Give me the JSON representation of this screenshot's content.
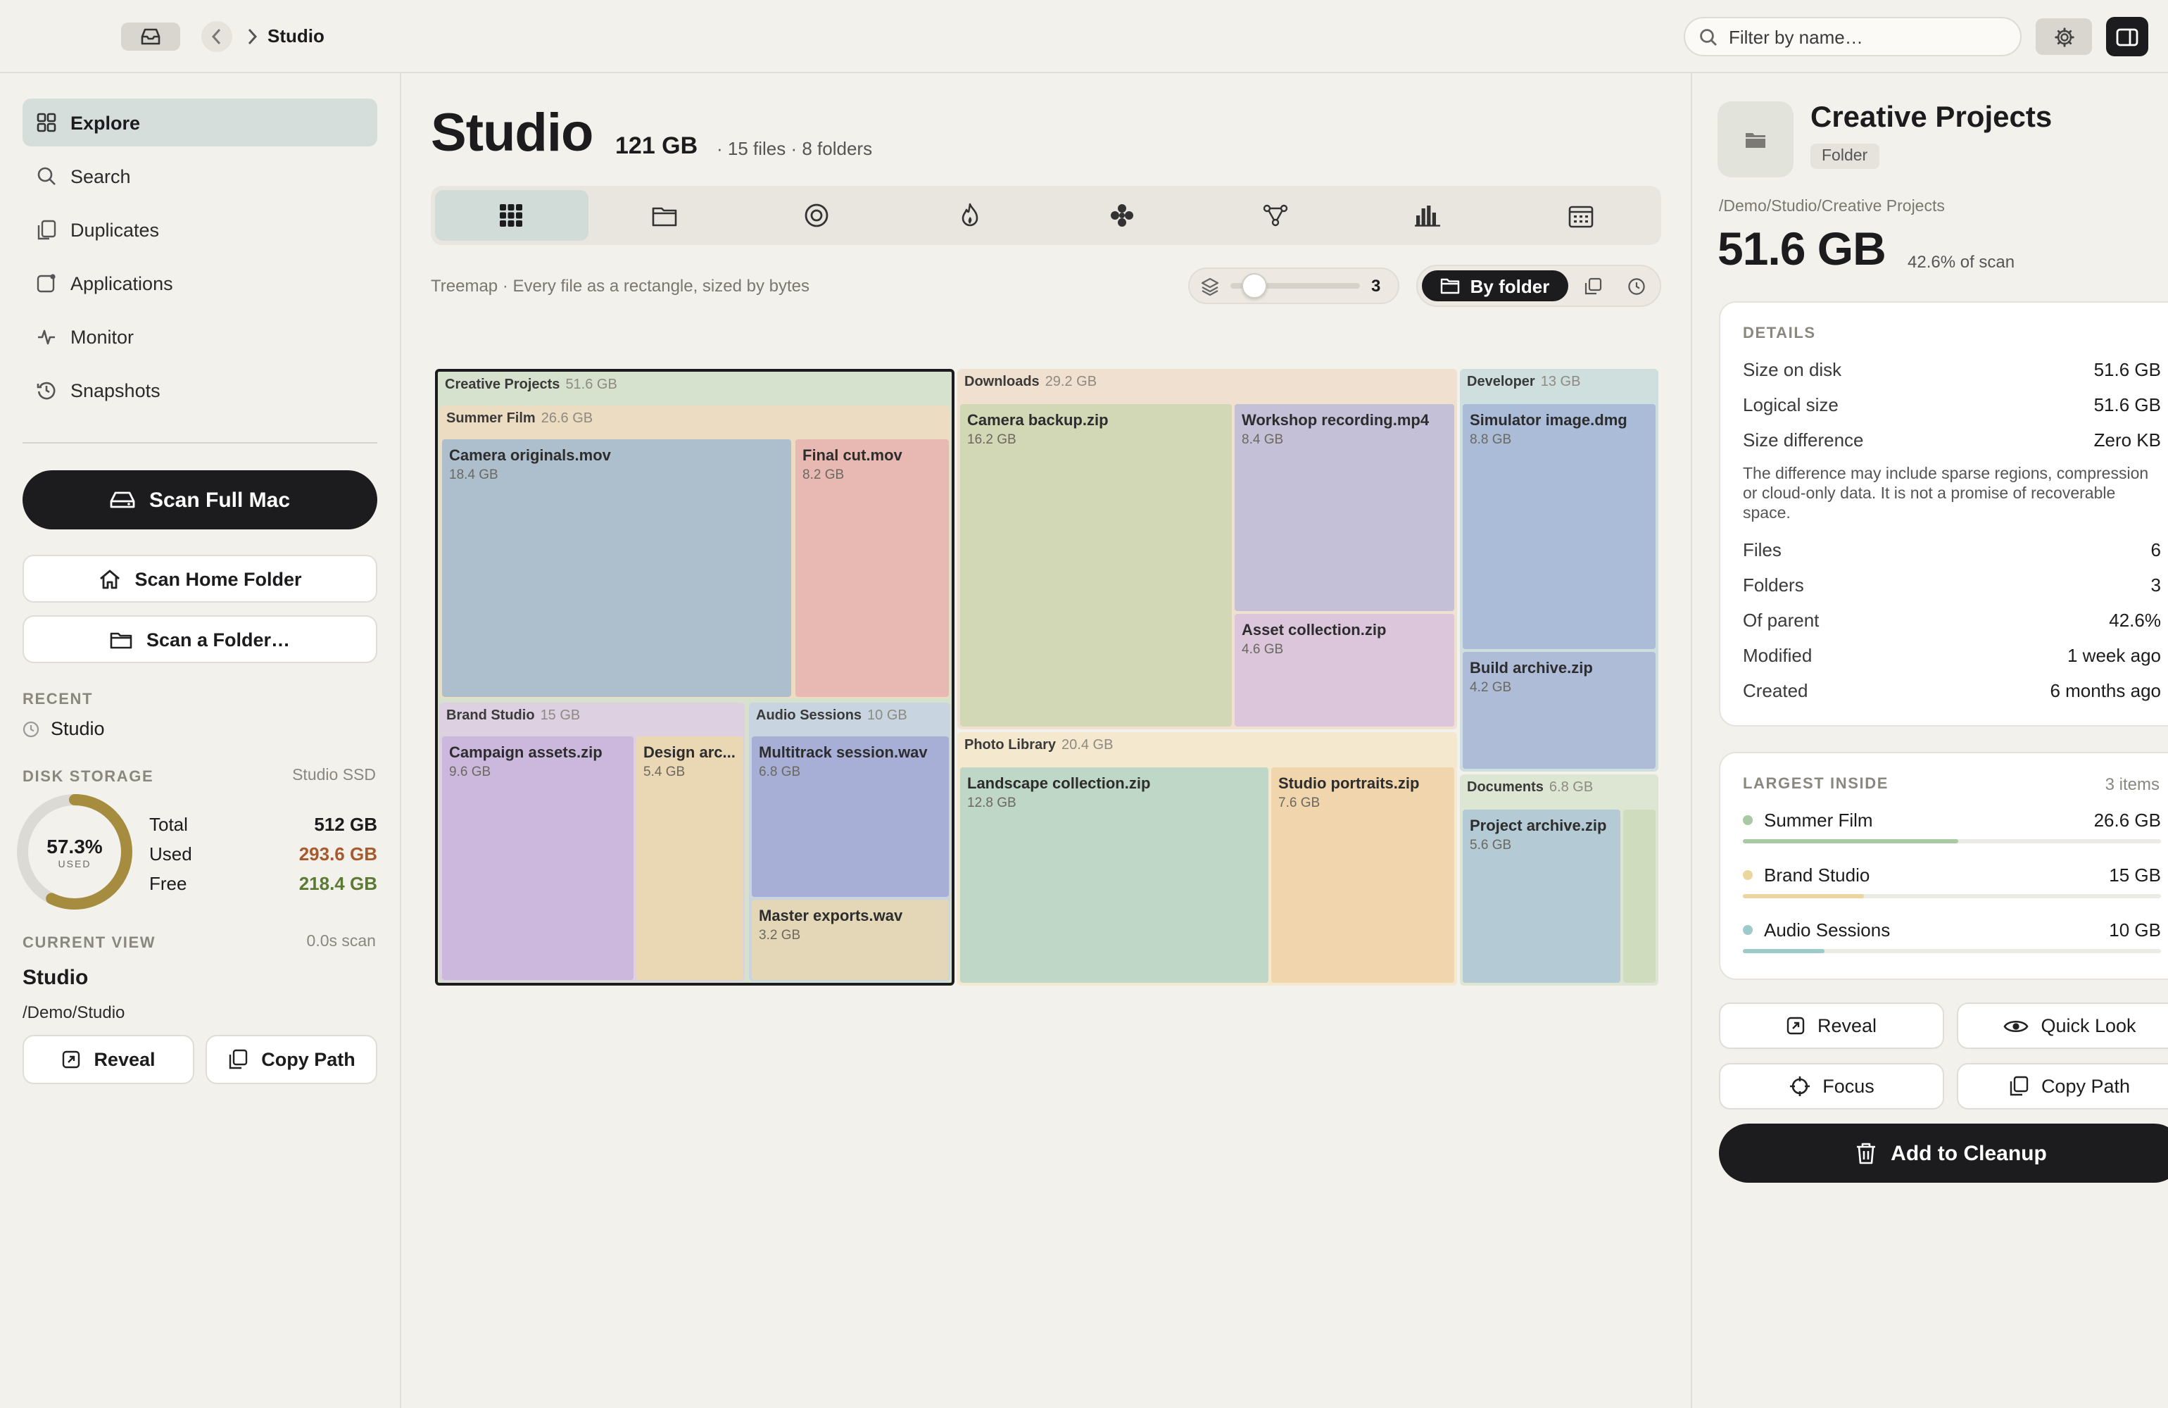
{
  "topbar": {
    "title": "Studio",
    "search_placeholder": "Filter by name…"
  },
  "sidebar": {
    "nav": [
      {
        "label": "Explore",
        "icon": "grid-icon",
        "active": true
      },
      {
        "label": "Search",
        "icon": "search-icon"
      },
      {
        "label": "Duplicates",
        "icon": "duplicates-icon"
      },
      {
        "label": "Applications",
        "icon": "applications-icon"
      },
      {
        "label": "Monitor",
        "icon": "pulse-icon"
      },
      {
        "label": "Snapshots",
        "icon": "history-icon"
      }
    ],
    "scan_full": "Scan Full Mac",
    "scan_home": "Scan Home Folder",
    "scan_folder": "Scan a Folder…",
    "recent_label": "RECENT",
    "recent_item": "Studio",
    "disk_label": "DISK STORAGE",
    "disk_name": "Studio SSD",
    "disk_pct": "57.3%",
    "disk_pct_value": 57.3,
    "disk_used_caption": "USED",
    "total_label": "Total",
    "total_value": "512 GB",
    "used_label": "Used",
    "used_value": "293.6 GB",
    "free_label": "Free",
    "free_value": "218.4 GB",
    "current_label": "CURRENT VIEW",
    "scan_time": "0.0s scan",
    "current_name": "Studio",
    "current_path": "/Demo/Studio",
    "reveal": "Reveal",
    "copy_path": "Copy Path"
  },
  "main": {
    "title": "Studio",
    "size": "121 GB",
    "meta": "· 15 files · 8 folders",
    "view_tabs": [
      "treemap-icon",
      "folder-icon",
      "sunburst-icon",
      "flame-icon",
      "cluster-icon",
      "network-icon",
      "bar-chart-icon",
      "calendar-icon"
    ],
    "desc": "Treemap · Every file as a rectangle, sized by bytes",
    "depth_value": "3",
    "group_by": "By folder"
  },
  "treemap": {
    "creative": {
      "name": "Creative Projects",
      "size": "51.6 GB"
    },
    "summer": {
      "name": "Summer Film",
      "size": "26.6 GB"
    },
    "camera_originals": {
      "name": "Camera originals.mov",
      "size": "18.4 GB"
    },
    "final_cut": {
      "name": "Final cut.mov",
      "size": "8.2 GB"
    },
    "brand": {
      "name": "Brand Studio",
      "size": "15 GB"
    },
    "campaign": {
      "name": "Campaign assets.zip",
      "size": "9.6 GB"
    },
    "design": {
      "name": "Design arc...",
      "size": "5.4 GB"
    },
    "audio": {
      "name": "Audio Sessions",
      "size": "10 GB"
    },
    "multitrack": {
      "name": "Multitrack session.wav",
      "size": "6.8 GB"
    },
    "master": {
      "name": "Master exports.wav",
      "size": "3.2 GB"
    },
    "downloads": {
      "name": "Downloads",
      "size": "29.2 GB"
    },
    "camera_backup": {
      "name": "Camera backup.zip",
      "size": "16.2 GB"
    },
    "workshop": {
      "name": "Workshop recording.mp4",
      "size": "8.4 GB"
    },
    "asset_collection": {
      "name": "Asset collection.zip",
      "size": "4.6 GB"
    },
    "photo": {
      "name": "Photo Library",
      "size": "20.4 GB"
    },
    "landscape": {
      "name": "Landscape collection.zip",
      "size": "12.8 GB"
    },
    "portraits": {
      "name": "Studio portraits.zip",
      "size": "7.6 GB"
    },
    "developer": {
      "name": "Developer",
      "size": "13 GB"
    },
    "simulator": {
      "name": "Simulator image.dmg",
      "size": "8.8 GB"
    },
    "build": {
      "name": "Build archive.zip",
      "size": "4.2 GB"
    },
    "documents": {
      "name": "Documents",
      "size": "6.8 GB"
    },
    "project_archive": {
      "name": "Project archive.zip",
      "size": "5.6 GB"
    }
  },
  "panel": {
    "name": "Creative Projects",
    "kind": "Folder",
    "path": "/Demo/Studio/Creative Projects",
    "size": "51.6 GB",
    "pct": "42.6% of scan",
    "details_title": "DETAILS",
    "details": [
      {
        "label": "Size on disk",
        "value": "51.6 GB"
      },
      {
        "label": "Logical size",
        "value": "51.6 GB"
      },
      {
        "label": "Size difference",
        "value": "Zero KB"
      }
    ],
    "note": "The difference may include sparse regions, compression or cloud-only data. It is not a promise of recoverable space.",
    "details2": [
      {
        "label": "Files",
        "value": "6"
      },
      {
        "label": "Folders",
        "value": "3"
      },
      {
        "label": "Of parent",
        "value": "42.6%"
      },
      {
        "label": "Modified",
        "value": "1 week ago"
      },
      {
        "label": "Created",
        "value": "6 months ago"
      }
    ],
    "largest_title": "LARGEST INSIDE",
    "largest_count": "3 items",
    "largest": [
      {
        "name": "Summer Film",
        "size": "26.6 GB",
        "fraction": 0.515,
        "color": "#a9c9a4"
      },
      {
        "name": "Brand Studio",
        "size": "15 GB",
        "fraction": 0.29,
        "color": "#ecd6a0"
      },
      {
        "name": "Audio Sessions",
        "size": "10 GB",
        "fraction": 0.194,
        "color": "#9ecac9"
      }
    ],
    "reveal": "Reveal",
    "quick_look": "Quick Look",
    "focus": "Focus",
    "copy_path": "Copy Path",
    "cleanup": "Add to Cleanup"
  }
}
